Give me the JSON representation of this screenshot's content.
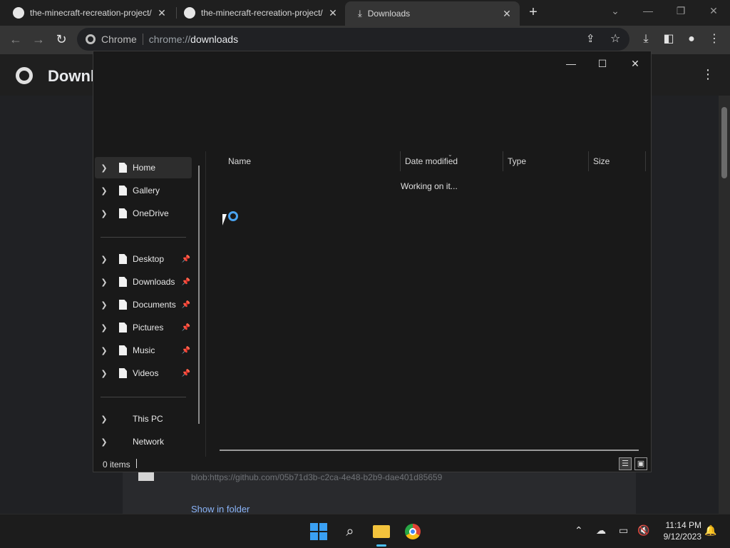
{
  "chrome": {
    "tabs": [
      {
        "title": "the-minecraft-recreation-project/"
      },
      {
        "title": "the-minecraft-recreation-project/"
      },
      {
        "title": "Downloads"
      }
    ],
    "new_tab_label": "+",
    "omnibox": {
      "chip": "Chrome",
      "url_prefix": "chrome://",
      "url_main": "downloads"
    }
  },
  "downloads_page": {
    "title": "Downloads",
    "item_url": "blob:https://github.com/05b71d3b-c2ca-4e48-b2b9-dae401d85659",
    "show_in_folder": "Show in folder"
  },
  "dialog": {
    "nav_items": [
      {
        "label": "Home",
        "pinned": false,
        "icon": "document-icon"
      },
      {
        "label": "Gallery",
        "pinned": false,
        "icon": "document-icon"
      },
      {
        "label": "OneDrive",
        "pinned": false,
        "icon": "document-icon"
      },
      {
        "label": "Desktop",
        "pinned": true,
        "icon": "document-icon"
      },
      {
        "label": "Downloads",
        "pinned": true,
        "icon": "document-icon"
      },
      {
        "label": "Documents",
        "pinned": true,
        "icon": "document-icon"
      },
      {
        "label": "Pictures",
        "pinned": true,
        "icon": "document-icon"
      },
      {
        "label": "Music",
        "pinned": true,
        "icon": "document-icon"
      },
      {
        "label": "Videos",
        "pinned": true,
        "icon": "document-icon"
      },
      {
        "label": "This PC",
        "pinned": false
      },
      {
        "label": "Network",
        "pinned": false
      }
    ],
    "columns": [
      "Name",
      "Date modified",
      "Type",
      "Size"
    ],
    "loading_text": "Working on it...",
    "status_count": "0 items"
  },
  "taskbar": {
    "time": "11:14 PM",
    "date": "9/12/2023"
  },
  "colors": {
    "accent": "#4cc2ff",
    "link": "#8ab4f8",
    "windows_blue": "#3aa0f3"
  }
}
